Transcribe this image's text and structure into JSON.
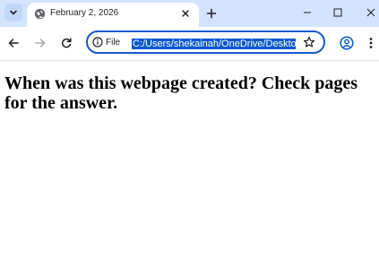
{
  "tabs": [
    {
      "title": "February 2, 2026",
      "active": true
    }
  ],
  "omnibox": {
    "site_chip_label": "File",
    "url": "C:/Users/shekainah/OneDrive/Desktop"
  },
  "page": {
    "heading": "When was this webpage created? Check pages for the answer."
  },
  "colors": {
    "tabstrip": "#d3e3fd",
    "omnibox_border": "#1a57c9",
    "selection": "#0b57d0"
  }
}
